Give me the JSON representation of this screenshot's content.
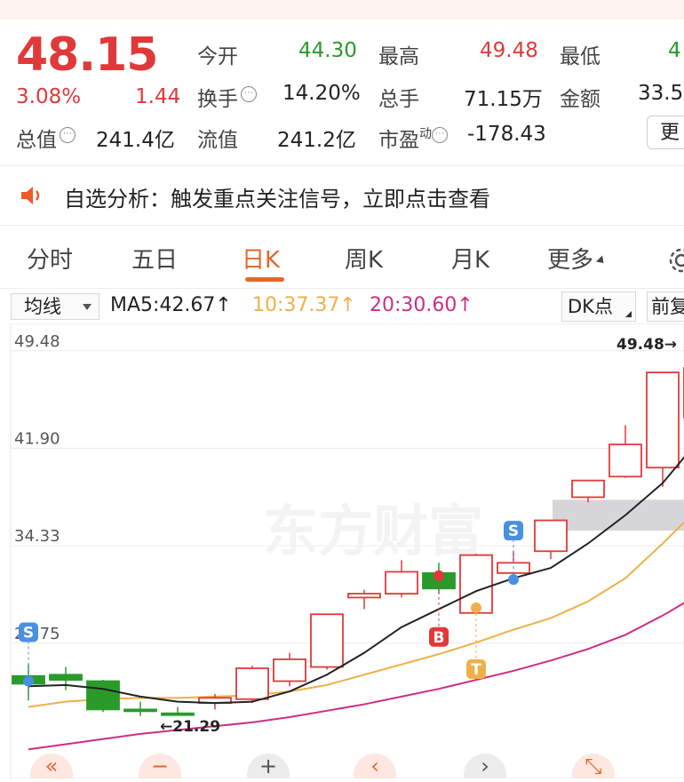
{
  "quote": {
    "price": "48.15",
    "change_pct": "3.08%",
    "change_amt": "1.44",
    "open_label": "今开",
    "open": "44.30",
    "high_label": "最高",
    "high": "49.48",
    "low_label": "最低",
    "low": "4",
    "turnover_label": "换手",
    "turnover": "14.20%",
    "volume_label": "总手",
    "volume": "71.15万",
    "amount_label": "金额",
    "amount": "33.5",
    "mktcap_label": "总值",
    "mktcap": "241.4亿",
    "float_label": "流值",
    "float": "241.2亿",
    "pe_label": "市盈",
    "pe_sup": "动",
    "pe": "-178.43",
    "more_label": "更"
  },
  "notice": {
    "text": "自选分析：触发重点关注信号，立即点击查看",
    "icon": "speaker-icon"
  },
  "tabs": [
    {
      "label": "分时"
    },
    {
      "label": "五日"
    },
    {
      "label": "日K"
    },
    {
      "label": "周K"
    },
    {
      "label": "月K"
    },
    {
      "label": "更多"
    }
  ],
  "active_tab": "日K",
  "ma_bar": {
    "select_label": "均线",
    "ma5": "MA5:42.67↑",
    "ma10": "10:37.37↑",
    "ma20": "20:30.60↑",
    "dk_label": "DK点",
    "fq_label": "前复"
  },
  "colors": {
    "up": "#e0393a",
    "down": "#2a9a2a",
    "accent": "#e2682b",
    "ma5": "#222222",
    "ma10": "#efb04a",
    "ma20": "#cc2e84"
  },
  "chart_data": {
    "type": "candlestick",
    "y_ticks": [
      "49.48",
      "41.90",
      "34.33",
      "26.75"
    ],
    "ylim": [
      19.0,
      50.5
    ],
    "max_label": "49.48→",
    "min_label": "←21.29",
    "watermark": "东方财富",
    "candles": [
      {
        "o": 24.2,
        "c": 23.6,
        "h": 25.1,
        "l": 22.3
      },
      {
        "o": 24.3,
        "c": 23.9,
        "h": 24.9,
        "l": 23.1
      },
      {
        "o": 23.8,
        "c": 21.6,
        "h": 23.9,
        "l": 21.4
      },
      {
        "o": 21.6,
        "c": 21.5,
        "h": 22.2,
        "l": 21.1
      },
      {
        "o": 21.3,
        "c": 21.2,
        "h": 21.8,
        "l": 21.29
      },
      {
        "o": 22.1,
        "c": 22.5,
        "h": 22.8,
        "l": 21.6
      },
      {
        "o": 22.4,
        "c": 24.8,
        "h": 25.0,
        "l": 22.1
      },
      {
        "o": 23.8,
        "c": 25.5,
        "h": 26.0,
        "l": 23.4
      },
      {
        "o": 24.9,
        "c": 29.0,
        "h": 29.0,
        "l": 24.7
      },
      {
        "o": 30.3,
        "c": 30.6,
        "h": 30.9,
        "l": 29.4
      },
      {
        "o": 30.6,
        "c": 32.3,
        "h": 33.2,
        "l": 30.3
      },
      {
        "o": 32.2,
        "c": 31.0,
        "h": 33.0,
        "l": 30.6
      },
      {
        "o": 29.1,
        "c": 33.6,
        "h": 33.7,
        "l": 29.0
      },
      {
        "o": 32.2,
        "c": 33.0,
        "h": 33.9,
        "l": 32.0
      },
      {
        "o": 33.9,
        "c": 36.3,
        "h": 36.3,
        "l": 33.3
      },
      {
        "o": 38.1,
        "c": 39.4,
        "h": 39.4,
        "l": 37.7
      },
      {
        "o": 39.7,
        "c": 42.2,
        "h": 43.7,
        "l": 39.6
      },
      {
        "o": 40.4,
        "c": 47.8,
        "h": 47.8,
        "l": 38.9
      },
      {
        "o": 44.3,
        "c": 48.15,
        "h": 49.48,
        "l": 44.0
      }
    ],
    "ma5": [
      23.4,
      23.5,
      23.2,
      22.6,
      22.2,
      22.1,
      22.2,
      23.0,
      24.3,
      26.0,
      28.0,
      29.4,
      30.8,
      31.8,
      32.6,
      34.5,
      36.7,
      39.2,
      42.67
    ],
    "ma10": [
      21.8,
      22.2,
      22.4,
      22.5,
      22.5,
      22.6,
      22.7,
      23.0,
      23.5,
      24.3,
      25.1,
      25.9,
      26.8,
      27.8,
      28.7,
      30.0,
      31.8,
      34.5,
      37.37
    ],
    "ma20": [
      18.5,
      18.9,
      19.3,
      19.7,
      20.0,
      20.3,
      20.6,
      21.0,
      21.5,
      22.0,
      22.6,
      23.2,
      23.9,
      24.6,
      25.4,
      26.3,
      27.4,
      28.9,
      30.6
    ],
    "signals": [
      {
        "label": "S",
        "candle": 0,
        "price": 23.8,
        "color": "#4a90e2"
      },
      {
        "label": "B",
        "candle": 11,
        "price": 32.0,
        "color": "#e0393a"
      },
      {
        "label": "T",
        "candle": 12,
        "price": 29.5,
        "color": "#efb04a"
      },
      {
        "label": "S",
        "candle": 13,
        "price": 31.7,
        "color": "#4a90e2"
      }
    ],
    "nav_buttons": [
      "«",
      "−",
      "+",
      "‹",
      "›",
      "⤡"
    ]
  }
}
